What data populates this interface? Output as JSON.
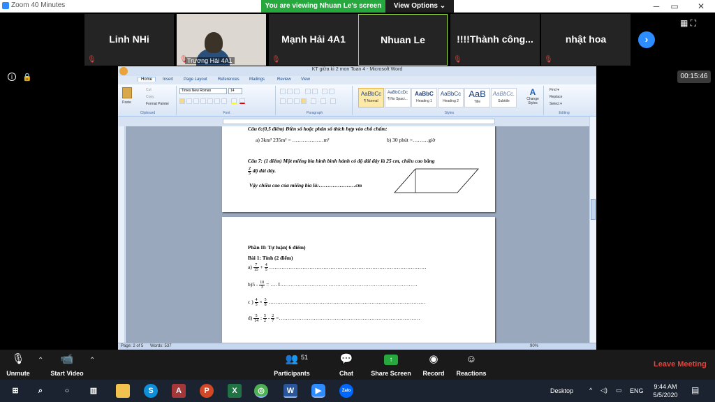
{
  "window": {
    "title": "Zoom 40 Minutes",
    "banner": "You are viewing Nhuan Le's screen",
    "view_options": "View Options ⌄",
    "min": "─",
    "max": "▭",
    "close": "✕"
  },
  "participants": [
    {
      "name": "Linh NHi",
      "video": false,
      "active": false
    },
    {
      "name": "Trương Hải 4A1",
      "video": true,
      "active": false
    },
    {
      "name": "Mạnh Hải 4A1",
      "video": false,
      "active": false
    },
    {
      "name": "Nhuan Le",
      "video": false,
      "active": true
    },
    {
      "name": "!!!!Thành công...",
      "video": false,
      "active": false
    },
    {
      "name": "nhật hoa",
      "video": false,
      "active": false
    }
  ],
  "timer": "00:15:46",
  "word": {
    "title": "KT giữa kì 2 mon Toan 4 - Microsoft Word",
    "tabs": [
      "Home",
      "Insert",
      "Page Layout",
      "References",
      "Mailings",
      "Review",
      "View"
    ],
    "clipboard": {
      "paste": "Paste",
      "cut": "Cut",
      "copy": "Copy",
      "format_painter": "Format Painter",
      "label": "Clipboard"
    },
    "font": {
      "name": "Times New Roman",
      "size": "14",
      "label": "Font"
    },
    "paragraph_label": "Paragraph",
    "styles": [
      {
        "preview": "AaBbCc",
        "name": "¶ Normal"
      },
      {
        "preview": "AaBbCcDc",
        "name": "¶ No Spaci..."
      },
      {
        "preview": "AaBbC",
        "name": "Heading 1"
      },
      {
        "preview": "AaBbCc",
        "name": "Heading 2"
      },
      {
        "preview": "AaB",
        "name": "Title"
      },
      {
        "preview": "AaBbCc.",
        "name": "Subtitle"
      }
    ],
    "styles_label": "Styles",
    "change_styles": "Change Styles",
    "editing": {
      "find": "Find ▾",
      "replace": "Replace",
      "select": "Select ▾",
      "label": "Editing"
    },
    "doc": {
      "q6_title": "Câu 6:(0,5 điểm) Điền số hoặc phân số thích hợp vào chỗ chấm:",
      "q6_a": "a) 3km² 235m² = ………………m²",
      "q6_b": "b) 30 phút =………giờ",
      "q7_title": "Câu 7: (1 điểm) Một miếng bìa hình bình hành có độ dài đáy là 25 cm, chiều cao bằng",
      "q7_frac_n": "2",
      "q7_frac_d": "5",
      "q7_cont": "độ dài đáy.",
      "q7_ask": "Vậy chiều cao của miếng bìa là:…………………cm",
      "part2": "Phần II: Tự luận( 6 điểm)",
      "bai1": "Bài  1: Tính (2 điểm)",
      "a_lbl": "a)",
      "a_n1": "7",
      "a_d1": "15",
      "a_op": "+",
      "a_n2": "4",
      "a_d2": "5",
      "a_dots": "………………………………………………………………………………",
      "b_lbl": "b)5 -",
      "b_n": "10",
      "b_d": "3",
      "b_dots": "= …. I……………………… ……………………………………………",
      "c_lbl": "c )",
      "c_n1": "4",
      "c_d1": "5",
      "c_op": "×",
      "c_n2": "5",
      "c_d2": "8",
      "c_dots": "………………………………………………………………………………",
      "d_lbl": "d)",
      "d_n1": "5",
      "d_d1": "14",
      "d_op1": ":",
      "d_n2": "5",
      "d_d2": "2",
      "d_op2": "-",
      "d_n3": "2",
      "d_d3": "7",
      "d_dots": "=………………………………………………………………………"
    },
    "status": {
      "page": "Page: 2 of 5",
      "words": "Words: 537",
      "zoom": "90%"
    }
  },
  "controls": {
    "unmute": "Unmute",
    "start_video": "Start Video",
    "participants": "Participants",
    "participants_count": "51",
    "chat": "Chat",
    "share_screen": "Share Screen",
    "record": "Record",
    "reactions": "Reactions",
    "leave": "Leave Meeting"
  },
  "taskbar": {
    "desktop": "Desktop",
    "lang": "ENG",
    "time": "9:44 AM",
    "date": "5/5/2020"
  },
  "colors": {
    "zoom_blue": "#2d8cff",
    "banner_green": "#26a83f",
    "leave_red": "#e0443e",
    "active_border": "#9ede47"
  }
}
